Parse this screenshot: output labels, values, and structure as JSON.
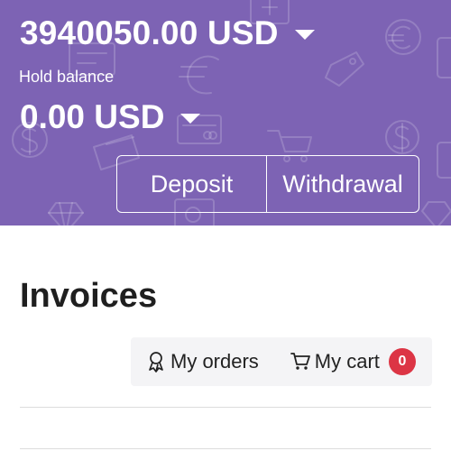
{
  "wallet": {
    "balance": "3940050.00 USD",
    "hold_label": "Hold balance",
    "hold_balance": "0.00 USD",
    "deposit_label": "Deposit",
    "withdrawal_label": "Withdrawal",
    "background_color": "#7d63b4"
  },
  "page": {
    "title": "Invoices"
  },
  "toolbar": {
    "orders_label": "My orders",
    "cart_label": "My cart",
    "cart_count": "0",
    "badge_color": "#dc3545"
  },
  "icons": {
    "orders": "award-ribbon-icon",
    "cart": "shopping-cart-icon",
    "caret": "caret-down-icon"
  }
}
